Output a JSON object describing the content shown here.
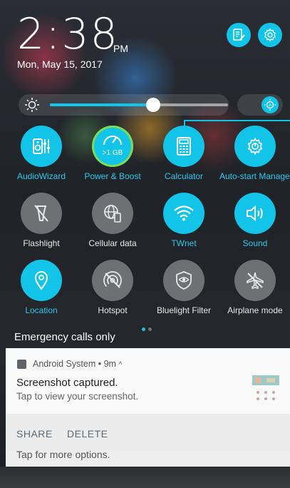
{
  "status": {
    "time": "2:38",
    "ampm": "PM",
    "date": "Mon, May 15, 2017"
  },
  "top_buttons": {
    "edit": "edit-notes-icon",
    "settings": "gear-icon"
  },
  "brightness": {
    "level": 0.58,
    "auto_icon": "auto-brightness-icon"
  },
  "tiles": [
    {
      "label": "AudioWizard",
      "icon": "audiowizard-icon",
      "state": "on"
    },
    {
      "label": "Power & Boost",
      "icon": "power-boost-icon",
      "state": "on",
      "badge": ">1 GB"
    },
    {
      "label": "Calculator",
      "icon": "calculator-icon",
      "state": "on"
    },
    {
      "label": "Auto-start Manager",
      "icon": "auto-start-gear-icon",
      "state": "on"
    },
    {
      "label": "Flashlight",
      "icon": "flashlight-off-icon",
      "state": "off"
    },
    {
      "label": "Cellular data",
      "icon": "cellular-data-icon",
      "state": "off"
    },
    {
      "label": "TWnet",
      "icon": "wifi-icon",
      "state": "on"
    },
    {
      "label": "Sound",
      "icon": "speaker-icon",
      "state": "on"
    },
    {
      "label": "Location",
      "icon": "location-pin-icon",
      "state": "on"
    },
    {
      "label": "Hotspot",
      "icon": "hotspot-off-icon",
      "state": "off"
    },
    {
      "label": "Bluelight Filter",
      "icon": "bluelight-filter-icon",
      "state": "off"
    },
    {
      "label": "Airplane mode",
      "icon": "airplane-off-icon",
      "state": "off"
    }
  ],
  "page_indicator": {
    "pages": 2,
    "current": 1
  },
  "emergency_text": "Emergency calls only",
  "notification": {
    "app": "Android System",
    "time": "9m",
    "title": "Screenshot captured.",
    "text": "Tap to view your screenshot.",
    "actions": [
      "SHARE",
      "DELETE"
    ]
  },
  "partial_notification_text": "Tap for more options.",
  "colors": {
    "accent": "#11c4e8",
    "tile_off": "#6e7074",
    "notification_bg": "#fafafa",
    "action_text": "#5c6b78"
  }
}
